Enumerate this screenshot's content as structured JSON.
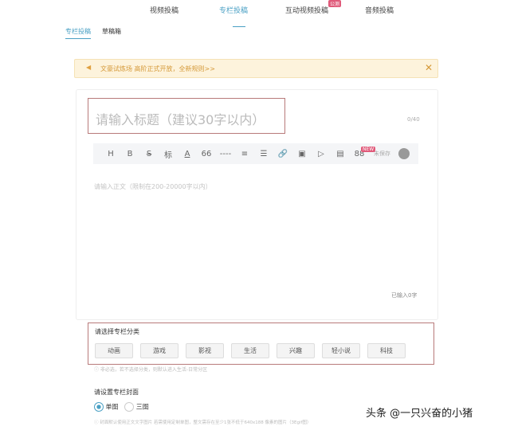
{
  "nav": {
    "items": [
      "视频投稿",
      "专栏投稿",
      "互动视频投稿",
      "音频投稿"
    ],
    "badge": "公测"
  },
  "subtabs": [
    "专栏投稿",
    "草稿箱"
  ],
  "banner": {
    "text": "文豪试炼场 高阶正式开放，全新规则>>"
  },
  "editor": {
    "title_placeholder": "请输入标题（建议30字以内）",
    "title_count": "0/40",
    "toolbar": [
      "H",
      "B",
      "S",
      "标",
      "A",
      "66",
      "----",
      "≡",
      "☰",
      "🔗",
      "▣",
      "▷",
      "▤",
      "88"
    ],
    "toolbar_badge": "NEW",
    "save_status": "未保存",
    "body_placeholder": "请输入正文（限制在200-20000字以内）",
    "word_count": "已输入0字"
  },
  "category": {
    "label": "请选择专栏分类",
    "options": [
      "动画",
      "游戏",
      "影视",
      "生活",
      "兴趣",
      "轻小说",
      "科技"
    ],
    "hint": "非必选，若不选择分类，则默认进入生活-日常分区"
  },
  "cover": {
    "label": "请设置专栏封面",
    "options": [
      "单图",
      "三图"
    ],
    "selected": "单图",
    "note": "封面默认使用正文文字图片 若需使用定制单图，整文需存在至少1张不低于640x188 像素的图片（3Egif图）"
  },
  "watermark": "头条 @一只兴奋的小猪"
}
